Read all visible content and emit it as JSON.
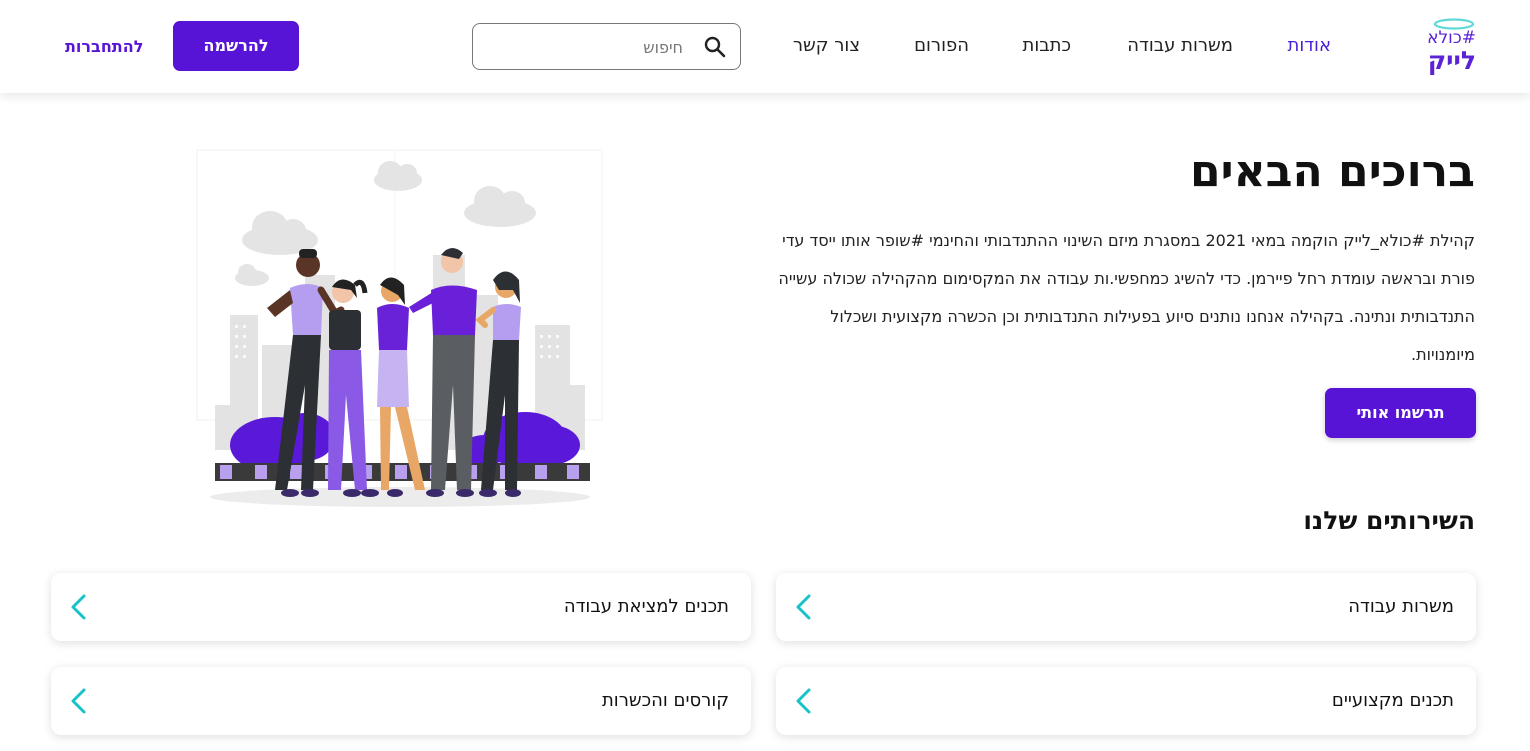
{
  "header": {
    "logo": {
      "top": "#כולא",
      "bottom": "לייק"
    },
    "nav": [
      {
        "label": "אודות",
        "active": true
      },
      {
        "label": "משרות עבודה",
        "active": false
      },
      {
        "label": "כתבות",
        "active": false
      },
      {
        "label": "הפורום",
        "active": false
      },
      {
        "label": "צור קשר",
        "active": false
      }
    ],
    "search": {
      "placeholder": "חיפוש",
      "value": "",
      "icon": "search-icon"
    },
    "register_label": "להרשמה",
    "login_label": "להתחברות"
  },
  "hero": {
    "title": "ברוכים הבאים",
    "text": "קהילת #כולא_לייק הוקמה במאי 2021 במסגרת מיזם השינוי ההתנדבותי והחינמי #שופר אותו ייסד עדי פורת ובראשה עומדת רחל פיירמן. כדי להשיג כמחפשי.ות עבודה את המקסימום מהקהילה שכולה עשייה התנדבותית ונתינה. בקהילה אנחנו נותנים סיוע בפעילות התנדבותית וכן הכשרה מקצועית ושכלול מיומנויות.",
    "cta_label": "תרשמו אותי"
  },
  "services": {
    "title": "השירותים שלנו",
    "items": [
      {
        "label": "משרות עבודה",
        "icon": "chevron-left-icon"
      },
      {
        "label": "תכנים למציאת עבודה",
        "icon": "chevron-left-icon"
      },
      {
        "label": "תכנים מקצועיים",
        "icon": "chevron-left-icon"
      },
      {
        "label": "קורסים והכשרות",
        "icon": "chevron-left-icon"
      }
    ]
  },
  "colors": {
    "brand_purple": "#5714d6",
    "nav_active": "#4a1fd6",
    "chevron_teal": "#17c3c9",
    "halo_teal": "#5fd8d8"
  }
}
